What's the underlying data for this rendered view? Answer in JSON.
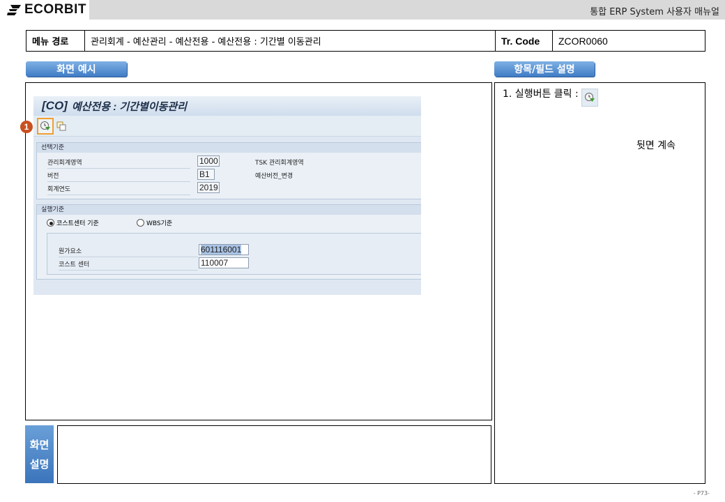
{
  "header": {
    "logo_text": "ECORBIT",
    "doc_title": "통합 ERP System 사용자 매뉴얼"
  },
  "menu_path": {
    "label": "메뉴 경로",
    "path": "관리회계 - 예산관리 - 예산전용 - 예산전용 : 기간별 이동관리",
    "trcode_label": "Tr. Code",
    "trcode_value": "ZCOR0060"
  },
  "tabs": {
    "screen_example": "화면 예시",
    "field_desc": "항목/필드 설명"
  },
  "sap": {
    "title_prefix": "[CO]",
    "title": "예산전용 : 기간별이동관리",
    "badge": "1",
    "selection_group": {
      "header": "선택기준",
      "rows": [
        {
          "label": "관리회계영역",
          "value": "1000",
          "desc": "TSK 관리회계영역"
        },
        {
          "label": "버전",
          "value": "B1",
          "desc": "예산버전_변경"
        },
        {
          "label": "회계연도",
          "value": "2019",
          "desc": ""
        }
      ]
    },
    "execution_group": {
      "header": "실행기준",
      "radio_cost_center": "코스트센터 기준",
      "radio_wbs": "WBS기준",
      "rows": [
        {
          "label": "원가요소",
          "value": "601116001"
        },
        {
          "label": "코스트 센터",
          "value": "110007"
        }
      ]
    }
  },
  "description": {
    "label_line1": "화면",
    "label_line2": "설명"
  },
  "right_panel": {
    "step_text": "1.  실행버튼 클릭 :",
    "continued": "뒷면 계속"
  },
  "page_number": "- P73-",
  "colors": {
    "accent_blue": "#3f7cc6",
    "highlight_orange": "#f0a030",
    "badge_red": "#c9501f",
    "execute_green": "#3a9a2a"
  }
}
